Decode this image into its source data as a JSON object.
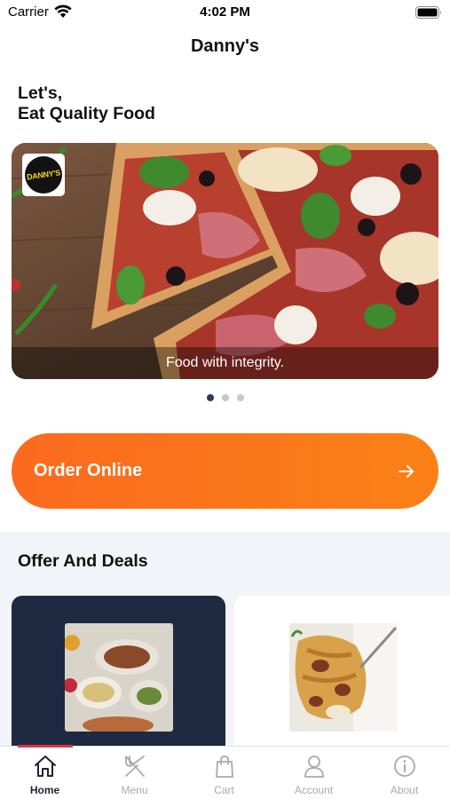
{
  "status_bar": {
    "carrier": "Carrier",
    "time": "4:02 PM"
  },
  "nav": {
    "title": "Danny's"
  },
  "hero": {
    "line1": "Let's,",
    "line2": "Eat Quality Food"
  },
  "banner": {
    "logo_text": "DANNY'S",
    "caption": "Food with integrity.",
    "slide_count": 3,
    "active_slide": 1
  },
  "order": {
    "label": "Order Online",
    "icon": "arrow-right-icon"
  },
  "offers": {
    "title": "Offer And Deals",
    "cards": 2
  },
  "tabs": [
    {
      "label": "Home",
      "icon": "home-icon",
      "active": true
    },
    {
      "label": "Menu",
      "icon": "fork-knife-icon",
      "active": false
    },
    {
      "label": "Cart",
      "icon": "bag-icon",
      "active": false
    },
    {
      "label": "Account",
      "icon": "person-icon",
      "active": false
    },
    {
      "label": "About",
      "icon": "info-icon",
      "active": false
    }
  ],
  "colors": {
    "accent_orange": "#fb7419",
    "tab_active": "#1b2438",
    "tab_inactive": "#a6a9b0",
    "indicator": "#e0343a",
    "dark_card": "#1e2a42"
  }
}
